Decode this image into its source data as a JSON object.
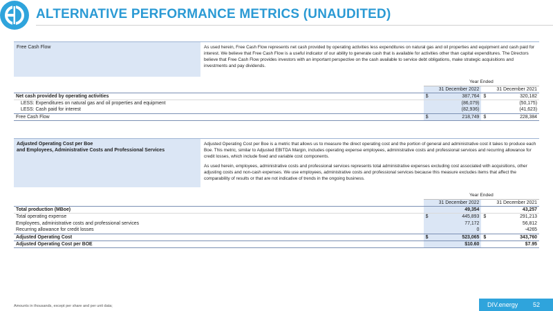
{
  "title": "ALTERNATIVE PERFORMANCE METRICS (UNAUDITED)",
  "fcf": {
    "label": "Free Cash Flow",
    "description": "As used herein, Free Cash Flow represents net cash provided by operating activities less expenditures on natural gas and oil properties and equipment and cash paid for interest. We believe that Free Cash Flow is a useful indicator of our ability to generate cash that is available for activities other than capital expenditures. The Directors believe that Free Cash Flow provides investors with an important perspective on the cash available to service debt obligations, make strategic acquisitions and investments and pay dividends.",
    "year_ended": "Year Ended",
    "col_2022": "31 December 2022",
    "col_2021": "31 December 2021",
    "rows": [
      {
        "label": "Net cash provided by operating activities",
        "cur1": "$",
        "v2022": "387,764",
        "cur2": "$",
        "v2021": "320,182"
      },
      {
        "label": "LESS: Expenditures on natural gas and oil properties and equipment",
        "cur1": "",
        "v2022": "(86,079)",
        "cur2": "",
        "v2021": "(50,175)"
      },
      {
        "label": "LESS: Cash paid for interest",
        "cur1": "",
        "v2022": "(82,936)",
        "cur2": "",
        "v2021": "(41,623)"
      },
      {
        "label": "Free Cash Flow",
        "cur1": "$",
        "v2022": "218,749",
        "cur2": "$",
        "v2021": "228,384"
      }
    ]
  },
  "aoc": {
    "label_line1": "Adjusted Operating Cost per Boe",
    "label_line2": "and Employees, Administrative Costs and Professional Services",
    "description_p1": "Adjusted Operating Cost per Boe is a metric that allows us to measure the direct operating cost and the portion of general and administrative cost it takes to produce each Boe. This metric, similar to Adjusted EBITDA Margin, includes operating expense employees, administrative costs and professional services and recurring allowance for credit losses, which include fixed and variable cost components.",
    "description_p2": "As used herein, employees, administrative costs and professional services represents total administrative expenses excluding cost associated with acquisitions, other adjusting costs and non-cash expenses. We use employees, administrative costs and professional services because this measure excludes items that affect the comparability of results or that are not indicative of trends in the ongoing business.",
    "year_ended": "Year Ended",
    "col_2022": "31 December 2022",
    "col_2021": "31 December 2021",
    "rows": [
      {
        "label": "Total production (MBoe)",
        "cur1": "",
        "v2022": "49,354",
        "cur2": "",
        "v2021": "43,257"
      },
      {
        "label": "Total operating expense",
        "cur1": "$",
        "v2022": "445,893",
        "cur2": "$",
        "v2021": "291,213"
      },
      {
        "label": "Employees, administrative costs and professional services",
        "cur1": "",
        "v2022": "77,172",
        "cur2": "",
        "v2021": "56,812"
      },
      {
        "label": "Recurring allowance for credit losses",
        "cur1": "",
        "v2022": "0",
        "cur2": "",
        "v2021": "-4265"
      },
      {
        "label": "Adjusted Operating Cost",
        "cur1": "$",
        "v2022": "523,065",
        "cur2": "$",
        "v2021": "343,760"
      },
      {
        "label": "Adjusted Operating Cost per BOE",
        "cur1": "",
        "v2022": "$10.60",
        "cur2": "",
        "v2021": "$7.95"
      }
    ]
  },
  "footer": {
    "note": "Amounts in thousands, except per share and per unit data;",
    "brand": "DIV.energy",
    "page": "52"
  },
  "colors": {
    "accent": "#2b9ad4",
    "band": "#dbe6f5",
    "rule": "#7a8fb3"
  },
  "icons": {
    "logo": "div-logo-icon"
  }
}
